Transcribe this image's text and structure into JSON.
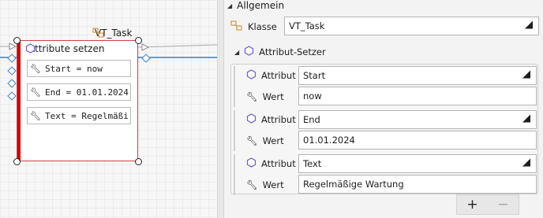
{
  "canvas": {
    "node": {
      "title": "Attribute setzen",
      "items": [
        {
          "text": "Start = now"
        },
        {
          "text": "End = 01.01.2024"
        },
        {
          "text": "Text = Regelmäßi"
        }
      ]
    },
    "task_label": "VT_Task"
  },
  "properties": {
    "section_title": "Allgemein",
    "class_label": "Klasse",
    "class_value": "VT_Task",
    "group_title": "Attribut-Setzer",
    "attribute_label": "Attribut",
    "value_label": "Wert",
    "setters": [
      {
        "attribute": "Start",
        "value": "now"
      },
      {
        "attribute": "End",
        "value": "01.01.2024"
      },
      {
        "attribute": "Text",
        "value": "Regelmäßige Wartung"
      }
    ],
    "add_button": "+",
    "remove_button": "−"
  },
  "colors": {
    "accent_red": "#d80000",
    "port_blue": "#3b7fc4",
    "icon_purple": "#6b5bd6",
    "icon_orange": "#c98a2a"
  }
}
